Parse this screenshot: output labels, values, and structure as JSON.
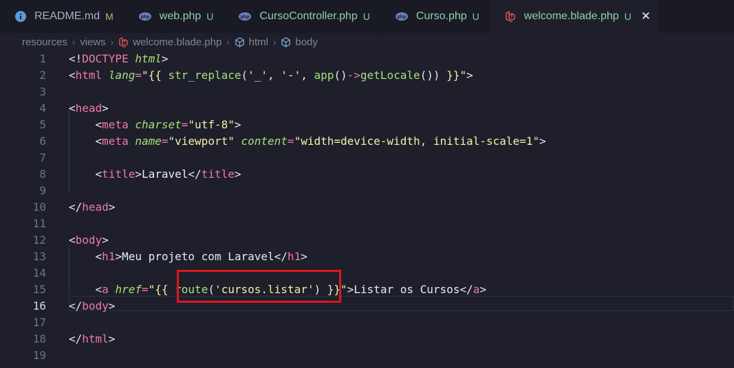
{
  "tabs": [
    {
      "label": "README.md",
      "badge": "M",
      "icon": "info-icon"
    },
    {
      "label": "web.php",
      "badge": "U",
      "icon": "php-icon"
    },
    {
      "label": "CursoController.php",
      "badge": "U",
      "icon": "php-icon"
    },
    {
      "label": "Curso.php",
      "badge": "U",
      "icon": "php-icon"
    },
    {
      "label": "welcome.blade.php",
      "badge": "U",
      "icon": "laravel-icon",
      "close": "✕"
    }
  ],
  "breadcrumb": {
    "items": [
      "resources",
      "views",
      "welcome.blade.php",
      "html",
      "body"
    ],
    "separator": "›"
  },
  "editor": {
    "line_numbers": [
      "1",
      "2",
      "3",
      "4",
      "5",
      "6",
      "7",
      "8",
      "9",
      "10",
      "11",
      "12",
      "13",
      "14",
      "15",
      "16",
      "17",
      "18",
      "19"
    ],
    "current_line": "16",
    "colors": {
      "tag": "#f07aa6",
      "attribute": "#a6e07a",
      "string": "#f4f0a8",
      "highlight": "#e0161d"
    }
  }
}
